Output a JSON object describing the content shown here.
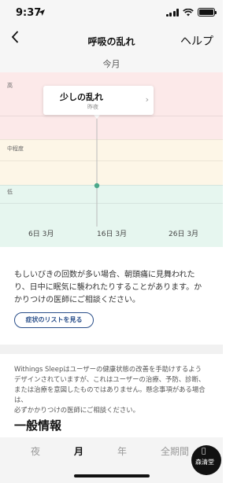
{
  "status_bar": {
    "time": "9:37",
    "location_icon": "location-arrow-icon",
    "signal_icon": "signal-bars-icon",
    "wifi_icon": "wifi-icon",
    "battery_icon": "battery-icon"
  },
  "nav": {
    "back_icon": "chevron-left-icon",
    "title": "呼吸の乱れ",
    "help_label": "ヘルプ"
  },
  "period": {
    "label": "今月"
  },
  "chart_data": {
    "type": "scatter",
    "categories": [
      "6日 3月",
      "16日 3月",
      "26日 3月"
    ],
    "y_categories": [
      "高",
      "中程度",
      "低"
    ],
    "points": [
      {
        "x": "16日 3月",
        "y": "低"
      }
    ],
    "bands": [
      {
        "label": "高",
        "color": "#fce9e9"
      },
      {
        "label": "中程度",
        "color": "#fdf6e7"
      },
      {
        "label": "低",
        "color": "#e6f6ef"
      }
    ],
    "point_color": "#4aa88a",
    "selection_line_color": "#bbbbbb"
  },
  "tooltip": {
    "title": "少しの乱れ",
    "subtitle": "昨夜",
    "chevron_icon": "chevron-right-icon"
  },
  "info": {
    "lines": [
      "もしいびきの回数が多い場合、朝頭痛に見舞われた",
      "り、日中に眠気に襲われたりすることがあります。か",
      "かりつけの医師にご相談ください。"
    ],
    "button_label": "症状のリストを見る"
  },
  "disclaimer": {
    "lines": [
      "Withings Sleepはユーザーの健康状態の改善を手助けするよう",
      "デザインされていますが、これはユーザーの治療、予防、診断、",
      "または治療を意図したものではありません。懸念事項がある場合は、",
      "必ずかかりつけの医師にご相談ください。"
    ]
  },
  "section": {
    "title": "一般情報"
  },
  "tabs": [
    {
      "label": "夜",
      "active": false
    },
    {
      "label": "月",
      "active": true
    },
    {
      "label": "年",
      "active": false
    },
    {
      "label": "全期間",
      "active": false
    }
  ],
  "watermark": {
    "apple_icon": "apple-logo-icon",
    "text": "森清堂"
  }
}
